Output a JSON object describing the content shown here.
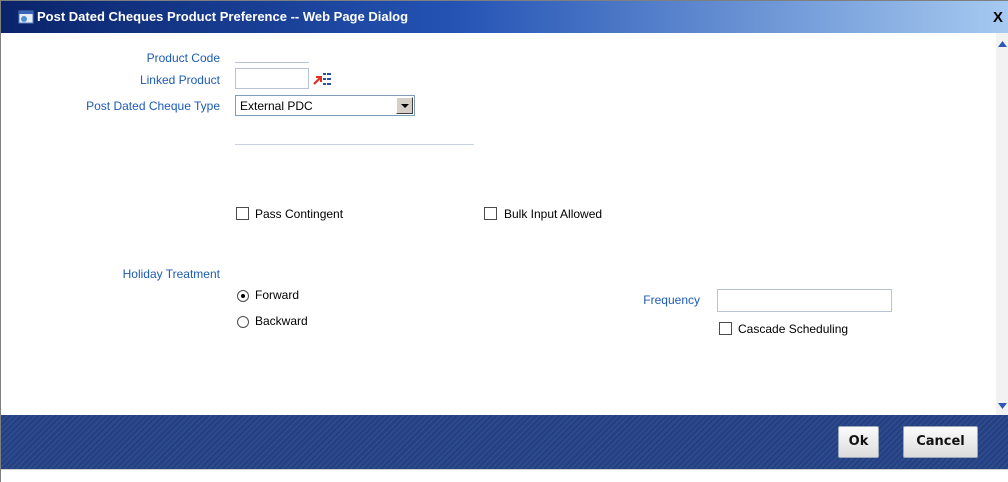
{
  "window": {
    "title": "Post Dated Cheques Product Preference -- Web Page Dialog",
    "close_glyph": "X"
  },
  "form": {
    "product_code": {
      "label": "Product Code",
      "value": ""
    },
    "linked_product": {
      "label": "Linked Product",
      "value": "",
      "lov_icon": "list-of-values-icon"
    },
    "pdc_type": {
      "label": "Post Dated Cheque Type",
      "value": "External PDC"
    },
    "pass_contingent": {
      "label": "Pass Contingent",
      "checked": false
    },
    "bulk_input": {
      "label": "Bulk Input Allowed",
      "checked": false
    },
    "holiday_treatment": {
      "label": "Holiday Treatment",
      "options": [
        {
          "label": "Forward",
          "selected": true
        },
        {
          "label": "Backward",
          "selected": false
        }
      ]
    },
    "frequency": {
      "label": "Frequency",
      "value": ""
    },
    "cascade_scheduling": {
      "label": "Cascade Scheduling",
      "checked": false
    }
  },
  "footer": {
    "ok_label": "Ok",
    "cancel_label": "Cancel"
  },
  "colors": {
    "label": "#1d5bb5",
    "title_bar": "#0a246a",
    "footer": "#2c4a8e"
  }
}
